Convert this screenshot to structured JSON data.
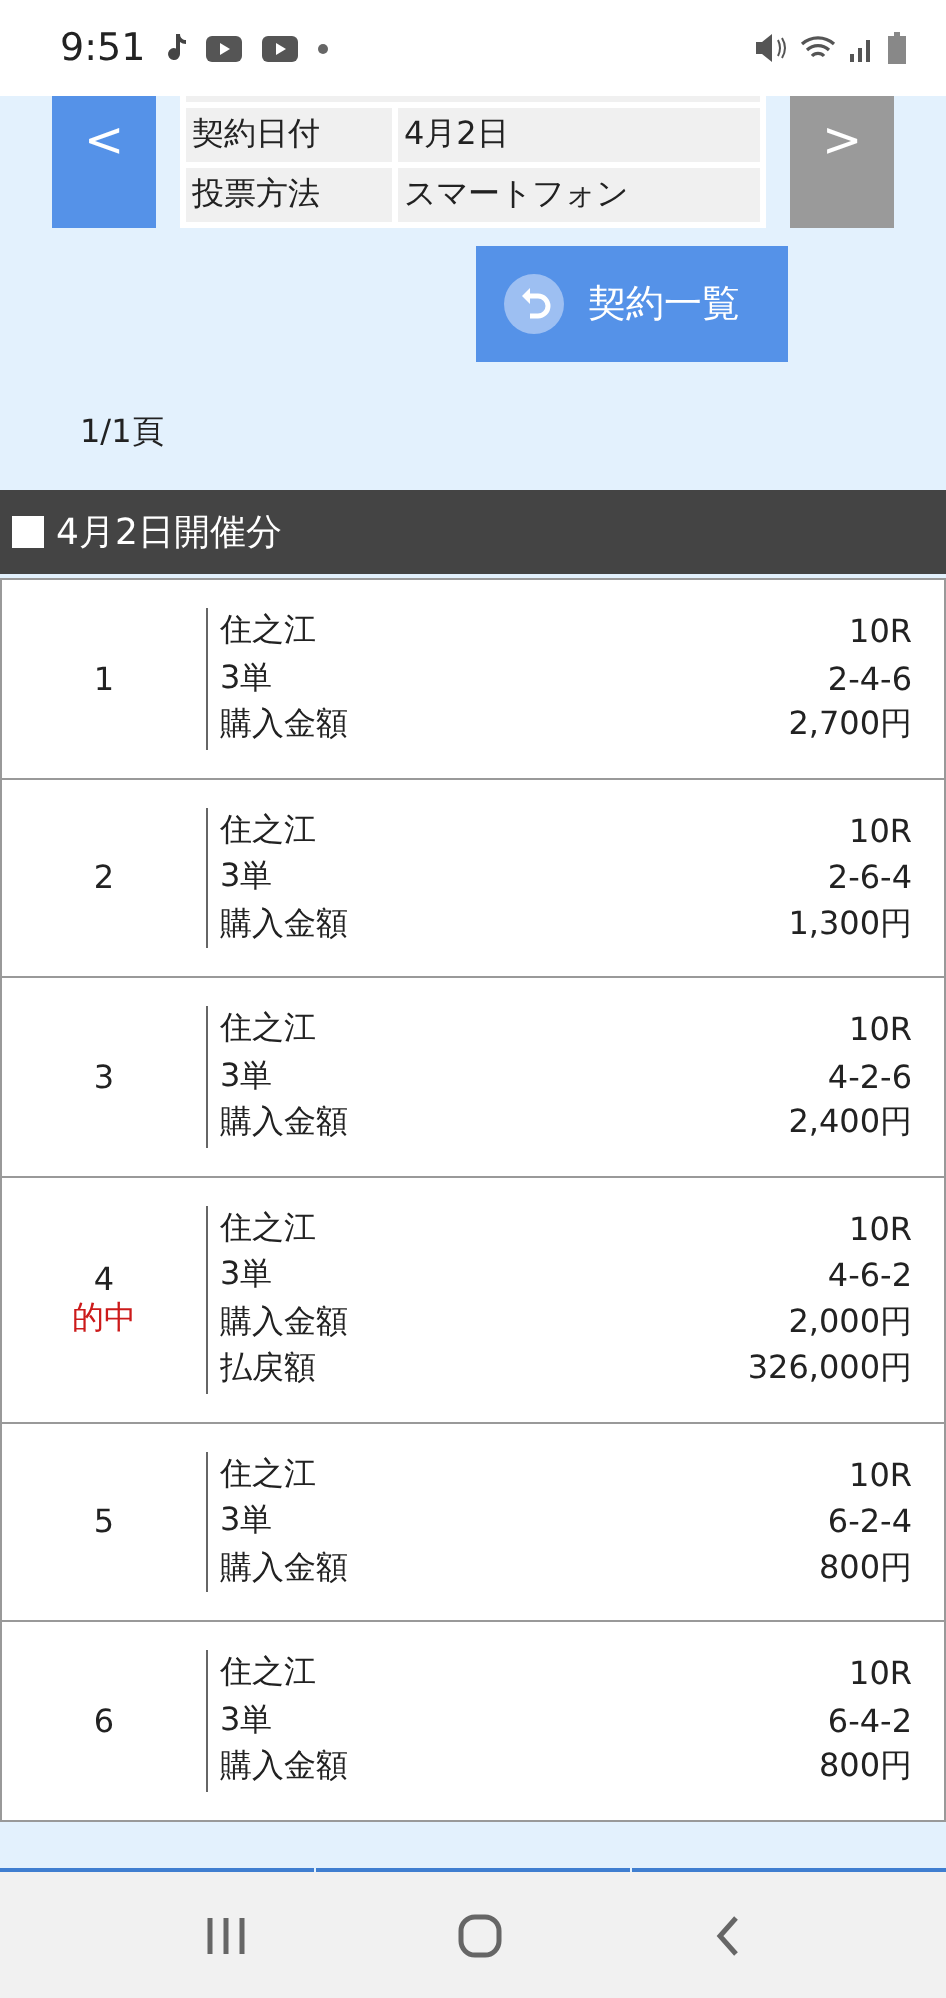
{
  "status_bar": {
    "time": "9:51"
  },
  "nav": {
    "prev": {
      "label": "<",
      "disabled": false
    },
    "next": {
      "label": ">",
      "disabled": true
    }
  },
  "info": [
    {
      "label": "契約日付",
      "value": "4月2日"
    },
    {
      "label": "投票方法",
      "value": "スマートフォン"
    }
  ],
  "list_button": {
    "label": "契約一覧"
  },
  "page": "1/1頁",
  "section": {
    "title": "4月2日開催分"
  },
  "bets": [
    {
      "no": "1",
      "lines": [
        {
          "label": "住之江",
          "value": "10R"
        },
        {
          "label": "3単",
          "value": "2-4-6"
        },
        {
          "label": "購入金額",
          "value": "2,700円"
        }
      ]
    },
    {
      "no": "2",
      "lines": [
        {
          "label": "住之江",
          "value": "10R"
        },
        {
          "label": "3単",
          "value": "2-6-4"
        },
        {
          "label": "購入金額",
          "value": "1,300円"
        }
      ]
    },
    {
      "no": "3",
      "lines": [
        {
          "label": "住之江",
          "value": "10R"
        },
        {
          "label": "3単",
          "value": "4-2-6"
        },
        {
          "label": "購入金額",
          "value": "2,400円"
        }
      ]
    },
    {
      "no": "4",
      "hit_label": "的中",
      "lines": [
        {
          "label": "住之江",
          "value": "10R"
        },
        {
          "label": "3単",
          "value": "4-6-2"
        },
        {
          "label": "購入金額",
          "value": "2,000円"
        },
        {
          "label": "払戻額",
          "value": "326,000円"
        }
      ]
    },
    {
      "no": "5",
      "lines": [
        {
          "label": "住之江",
          "value": "10R"
        },
        {
          "label": "3単",
          "value": "6-2-4"
        },
        {
          "label": "購入金額",
          "value": "800円"
        }
      ]
    },
    {
      "no": "6",
      "lines": [
        {
          "label": "住之江",
          "value": "10R"
        },
        {
          "label": "3単",
          "value": "6-4-2"
        },
        {
          "label": "購入金額",
          "value": "800円"
        }
      ]
    }
  ]
}
